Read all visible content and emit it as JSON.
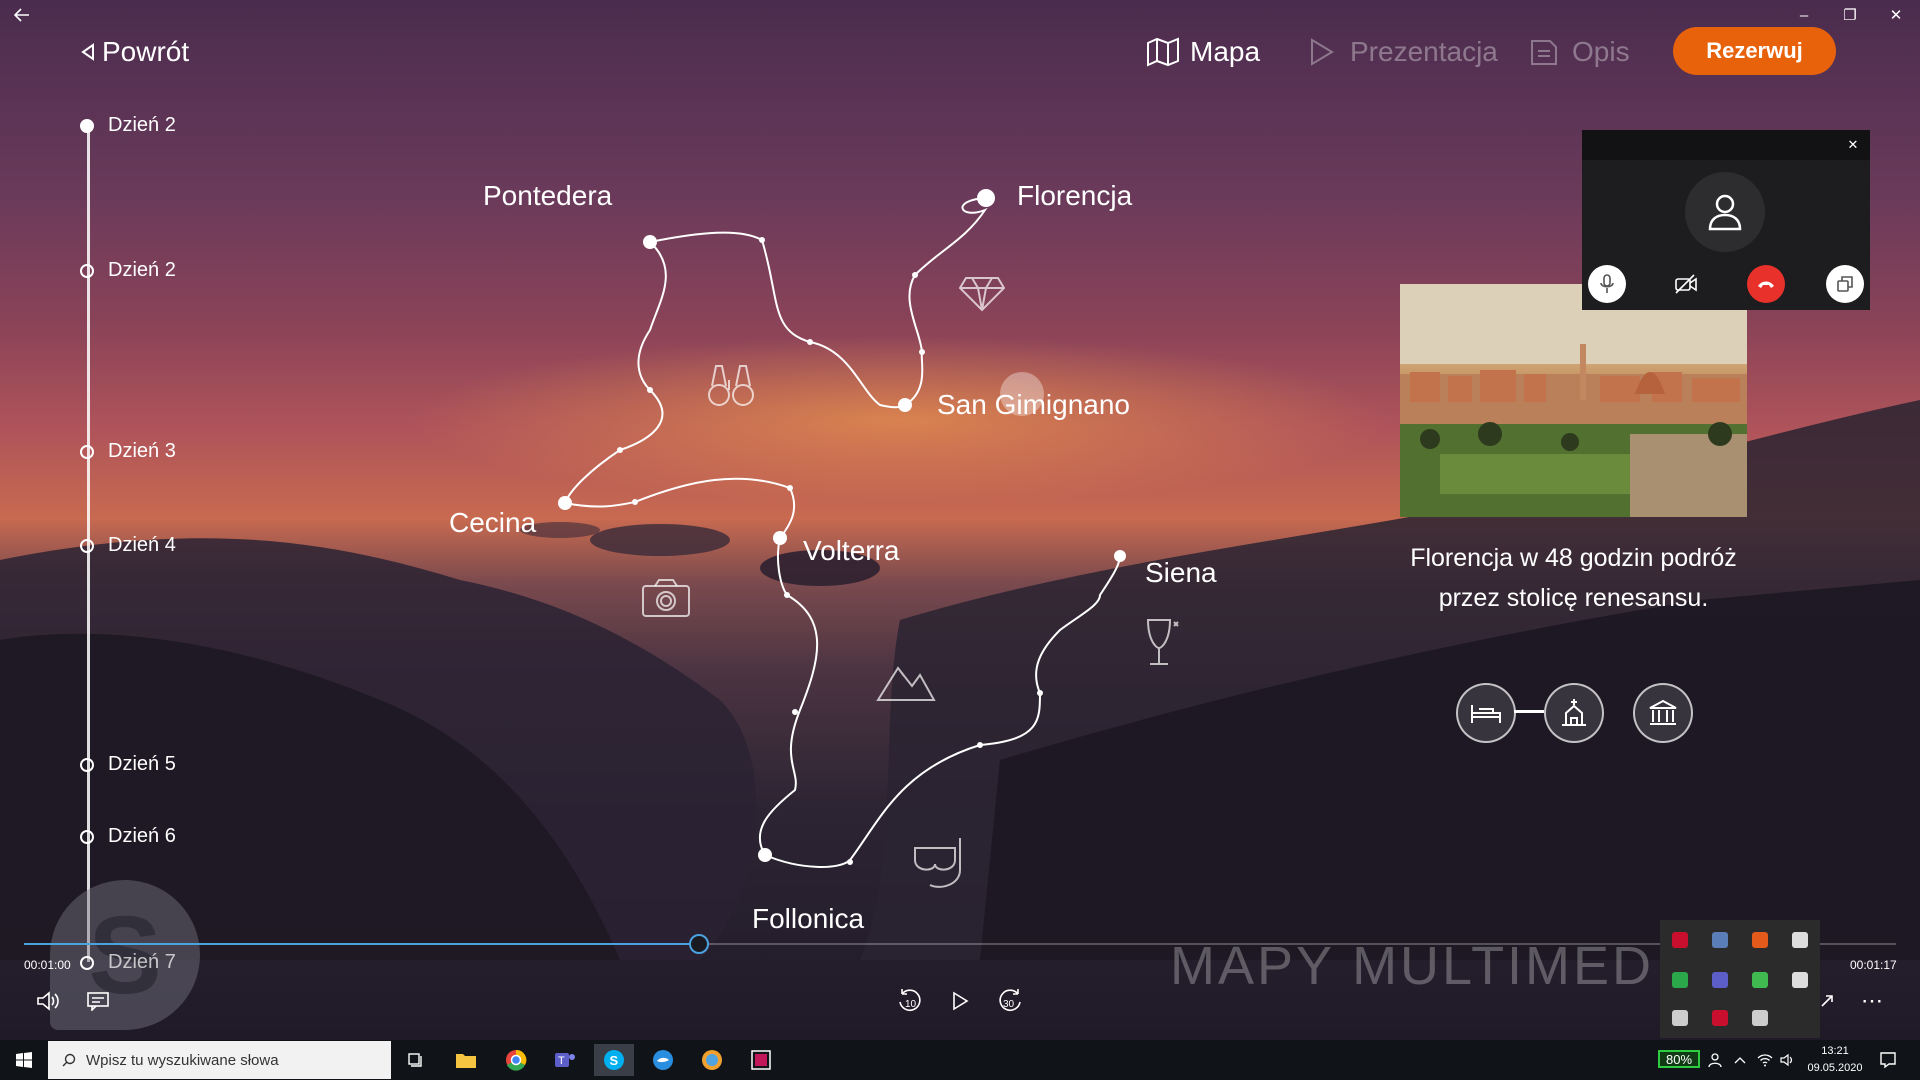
{
  "window": {
    "back_icon": "arrow-left-icon",
    "minimize": "–",
    "restore": "❐",
    "close": "✕"
  },
  "nav": {
    "back_label": "Powrót",
    "map_label": "Mapa",
    "presentation_label": "Prezentacja",
    "description_label": "Opis",
    "reserve_label": "Rezerwuj",
    "reserve_color": "#e8620c"
  },
  "timeline": {
    "days": [
      "Dzień 2",
      "Dzień 2",
      "Dzień 3",
      "Dzień 4",
      "Dzień 5",
      "Dzień 6",
      "Dzień 7"
    ]
  },
  "map": {
    "cities": {
      "pontedera": "Pontedera",
      "florencja": "Florencja",
      "san_gimignano": "San Gimignano",
      "cecina": "Cecina",
      "volterra": "Volterra",
      "siena": "Siena",
      "follonica": "Follonica"
    }
  },
  "call": {
    "close": "✕"
  },
  "info": {
    "description": "Florencja w 48 godzin podróż przez stolicę renesansu."
  },
  "player": {
    "current_time": "00:01:00",
    "total_time": "00:01:17",
    "progress": 0.36,
    "rewind_label": "10",
    "forward_label": "30",
    "more": "⋯"
  },
  "brand": {
    "text": "MAPY MULTIMED"
  },
  "taskbar": {
    "search_placeholder": "Wpisz tu wyszukiwane słowa",
    "battery": "80%",
    "time": "13:21",
    "date": "09.05.2020"
  }
}
